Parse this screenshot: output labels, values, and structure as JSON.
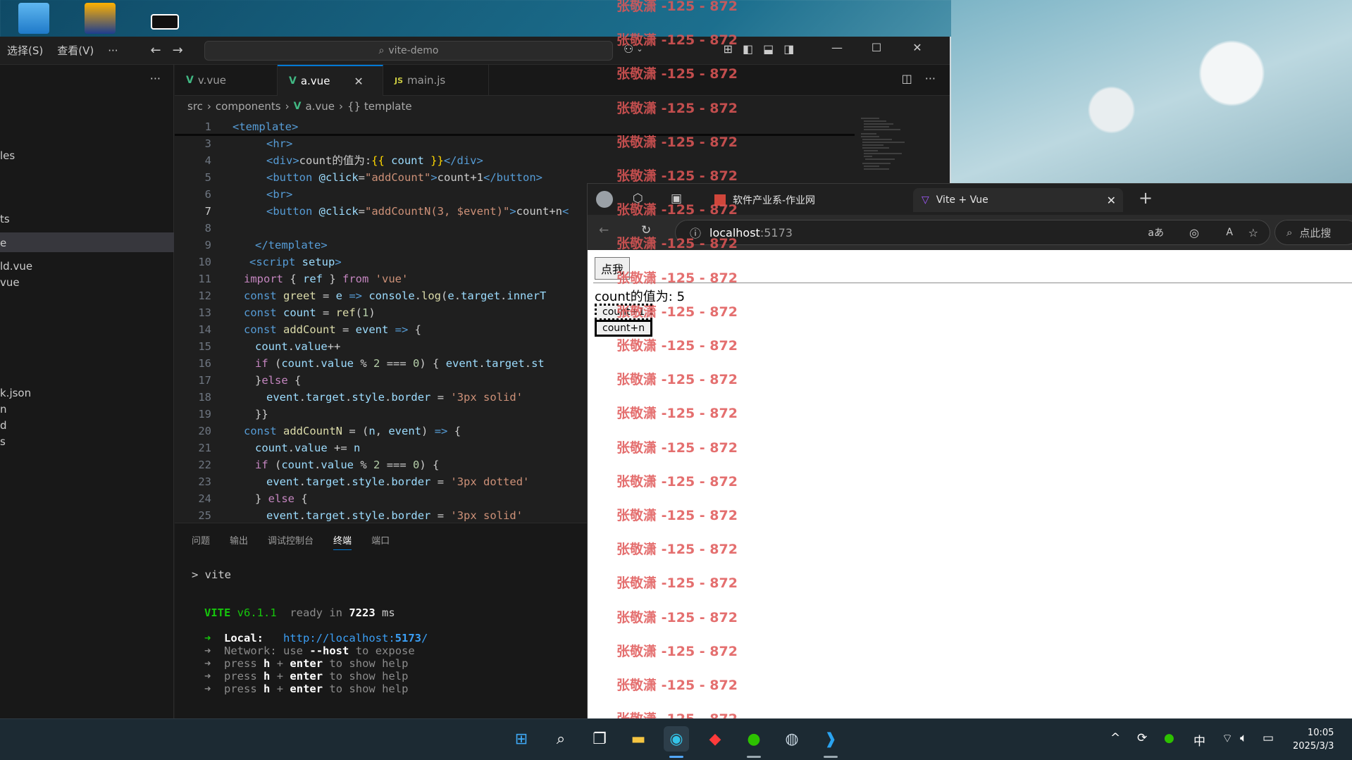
{
  "vscode": {
    "menu": [
      "选择(S)",
      "查看(V)",
      "···"
    ],
    "command_center": "vite-demo",
    "window_controls": {
      "minimize": "—",
      "maximize": "☐",
      "close": "✕"
    },
    "sidebar_partial_items": [
      "les",
      "ts",
      "e",
      "ld.vue",
      "vue",
      "k.json",
      "n",
      "d",
      "s"
    ],
    "tabs": [
      {
        "icon": "vue-icon",
        "label": "v.vue",
        "active": false
      },
      {
        "icon": "vue-icon",
        "label": "a.vue",
        "active": true
      },
      {
        "icon": "js-icon",
        "label": "main.js",
        "active": false
      }
    ],
    "breadcrumb": [
      "src",
      "components",
      "a.vue",
      "{} template"
    ],
    "code_lines": [
      {
        "n": "1",
        "tokens": [
          [
            "t",
            "<template>"
          ]
        ]
      },
      {
        "n": "3",
        "tokens": [
          [
            "t",
            "<hr>"
          ]
        ]
      },
      {
        "n": "4",
        "tokens": [
          [
            "t",
            "<div>"
          ],
          [
            "p",
            "count的值为:"
          ],
          [
            "y",
            "{{ "
          ],
          [
            "v",
            "count"
          ],
          [
            "y",
            " }}"
          ],
          [
            "t",
            "</div>"
          ]
        ]
      },
      {
        "n": "5",
        "tokens": [
          [
            "t",
            "<button "
          ],
          [
            "v",
            "@click"
          ],
          [
            "p",
            "="
          ],
          [
            "s",
            "\"addCount\""
          ],
          [
            "t",
            ">"
          ],
          [
            "p",
            "count+1"
          ],
          [
            "t",
            "</button>"
          ]
        ]
      },
      {
        "n": "6",
        "tokens": [
          [
            "t",
            "<br>"
          ]
        ]
      },
      {
        "n": "7",
        "tokens": [
          [
            "t",
            "<button "
          ],
          [
            "v",
            "@click"
          ],
          [
            "p",
            "="
          ],
          [
            "s",
            "\"addCountN(3, $event)\""
          ],
          [
            "t",
            ">"
          ],
          [
            "p",
            "count+n"
          ],
          [
            "t",
            "<"
          ]
        ]
      },
      {
        "n": "8",
        "tokens": []
      },
      {
        "n": "9",
        "tokens": [
          [
            "t",
            "</template>"
          ]
        ]
      },
      {
        "n": "10",
        "tokens": [
          [
            "t",
            "<script "
          ],
          [
            "v",
            "setup"
          ],
          [
            "t",
            ">"
          ]
        ]
      },
      {
        "n": "11",
        "tokens": [
          [
            "kw",
            "import "
          ],
          [
            "p",
            "{ "
          ],
          [
            "v",
            "ref "
          ],
          [
            "p",
            "} "
          ],
          [
            "kw",
            "from "
          ],
          [
            "s",
            "'vue'"
          ]
        ]
      },
      {
        "n": "12",
        "tokens": [
          [
            "k",
            "const "
          ],
          [
            "f",
            "greet"
          ],
          [
            "p",
            " = "
          ],
          [
            "v",
            "e"
          ],
          [
            "k",
            " => "
          ],
          [
            "v",
            "console"
          ],
          [
            "p",
            "."
          ],
          [
            "f",
            "log"
          ],
          [
            "p",
            "("
          ],
          [
            "v",
            "e"
          ],
          [
            "p",
            "."
          ],
          [
            "v",
            "target"
          ],
          [
            "p",
            "."
          ],
          [
            "v",
            "innerT"
          ]
        ]
      },
      {
        "n": "13",
        "tokens": [
          [
            "k",
            "const "
          ],
          [
            "v",
            "count"
          ],
          [
            "p",
            " = "
          ],
          [
            "f",
            "ref"
          ],
          [
            "p",
            "("
          ],
          [
            "n",
            "1"
          ],
          [
            "p",
            ")"
          ]
        ]
      },
      {
        "n": "14",
        "tokens": [
          [
            "k",
            "const "
          ],
          [
            "f",
            "addCount"
          ],
          [
            "p",
            " = "
          ],
          [
            "v",
            "event"
          ],
          [
            "k",
            " => "
          ],
          [
            "p",
            "{"
          ]
        ]
      },
      {
        "n": "15",
        "tokens": [
          [
            "v",
            "count"
          ],
          [
            "p",
            "."
          ],
          [
            "v",
            "value"
          ],
          [
            "p",
            "++"
          ]
        ]
      },
      {
        "n": "16",
        "tokens": [
          [
            "kw",
            "if "
          ],
          [
            "p",
            "("
          ],
          [
            "v",
            "count"
          ],
          [
            "p",
            "."
          ],
          [
            "v",
            "value"
          ],
          [
            "p",
            " % "
          ],
          [
            "n",
            "2"
          ],
          [
            "p",
            " === "
          ],
          [
            "n",
            "0"
          ],
          [
            "p",
            ") { "
          ],
          [
            "v",
            "event"
          ],
          [
            "p",
            "."
          ],
          [
            "v",
            "target"
          ],
          [
            "p",
            "."
          ],
          [
            "v",
            "st"
          ]
        ]
      },
      {
        "n": "17",
        "tokens": [
          [
            "p",
            "}"
          ],
          [
            "kw",
            "else "
          ],
          [
            "p",
            "{"
          ]
        ]
      },
      {
        "n": "18",
        "tokens": [
          [
            "v",
            "event"
          ],
          [
            "p",
            "."
          ],
          [
            "v",
            "target"
          ],
          [
            "p",
            "."
          ],
          [
            "v",
            "style"
          ],
          [
            "p",
            "."
          ],
          [
            "v",
            "border"
          ],
          [
            "p",
            " = "
          ],
          [
            "s",
            "'3px solid'"
          ]
        ]
      },
      {
        "n": "19",
        "tokens": [
          [
            "p",
            "}}"
          ]
        ]
      },
      {
        "n": "20",
        "tokens": [
          [
            "k",
            "const "
          ],
          [
            "f",
            "addCountN"
          ],
          [
            "p",
            " = ("
          ],
          [
            "v",
            "n"
          ],
          [
            "p",
            ", "
          ],
          [
            "v",
            "event"
          ],
          [
            "p",
            ") "
          ],
          [
            "k",
            "=> "
          ],
          [
            "p",
            "{"
          ]
        ]
      },
      {
        "n": "21",
        "tokens": [
          [
            "v",
            "count"
          ],
          [
            "p",
            "."
          ],
          [
            "v",
            "value"
          ],
          [
            "p",
            " += "
          ],
          [
            "v",
            "n"
          ]
        ]
      },
      {
        "n": "22",
        "tokens": [
          [
            "kw",
            "if "
          ],
          [
            "p",
            "("
          ],
          [
            "v",
            "count"
          ],
          [
            "p",
            "."
          ],
          [
            "v",
            "value"
          ],
          [
            "p",
            " % "
          ],
          [
            "n",
            "2"
          ],
          [
            "p",
            " === "
          ],
          [
            "n",
            "0"
          ],
          [
            "p",
            ") {"
          ]
        ]
      },
      {
        "n": "23",
        "tokens": [
          [
            "v",
            "event"
          ],
          [
            "p",
            "."
          ],
          [
            "v",
            "target"
          ],
          [
            "p",
            "."
          ],
          [
            "v",
            "style"
          ],
          [
            "p",
            "."
          ],
          [
            "v",
            "border"
          ],
          [
            "p",
            " = "
          ],
          [
            "s",
            "'3px dotted'"
          ]
        ]
      },
      {
        "n": "24",
        "tokens": [
          [
            "p",
            "} "
          ],
          [
            "kw",
            "else "
          ],
          [
            "p",
            "{"
          ]
        ]
      },
      {
        "n": "25",
        "tokens": [
          [
            "v",
            "event"
          ],
          [
            "p",
            "."
          ],
          [
            "v",
            "target"
          ],
          [
            "p",
            "."
          ],
          [
            "v",
            "style"
          ],
          [
            "p",
            "."
          ],
          [
            "v",
            "border"
          ],
          [
            "p",
            " = "
          ],
          [
            "s",
            "'3px solid'"
          ]
        ]
      }
    ],
    "panel_tabs": [
      "问题",
      "输出",
      "调试控制台",
      "终端",
      "端口"
    ],
    "terminal": {
      "prompt": "> vite",
      "vite_label": "VITE",
      "version": "v6.1.1",
      "ready_text": "ready in",
      "ready_ms": "7223",
      "ms_unit": "ms",
      "local_label": "Local:",
      "local_url_prefix": "http://localhost:",
      "local_url_port": "5173",
      "local_url_suffix": "/",
      "network_label": "Network:",
      "network_use": "use",
      "network_flag": "--host",
      "network_rest": "to expose",
      "press": "press",
      "h": "h",
      "plus": "+",
      "enter": "enter",
      "help_rest": "to show help",
      "arrow": "➜"
    }
  },
  "browser": {
    "tabs": [
      {
        "label": "软件产业系-作业网",
        "active": false
      },
      {
        "label": "Vite + Vue",
        "active": true
      }
    ],
    "new_tab": "+",
    "address_host": "localhost",
    "address_port": ":5173",
    "search_placeholder": "点此搜",
    "page": {
      "button1": "点我",
      "count_text": "count的值为: 5",
      "button2": "count+1",
      "button3": "count+n"
    }
  },
  "watermark_text": "张敬潇 -125 - 872",
  "taskbar": {
    "icons": [
      "windows-start-icon",
      "search-icon",
      "task-view-icon",
      "file-explorer-icon",
      "edge-icon",
      "app-red-icon",
      "wechat-icon",
      "steam-icon",
      "vscode-icon"
    ],
    "tray": {
      "chevron": "^",
      "ime": "中"
    },
    "time": "10:05",
    "date": "2025/3/3"
  },
  "colors": {
    "vscode_bg": "#1f1f1f",
    "accent": "#0078d4",
    "vue_green": "#41b883",
    "watermark": "#e05757",
    "taskbar": "#1c2a33"
  }
}
